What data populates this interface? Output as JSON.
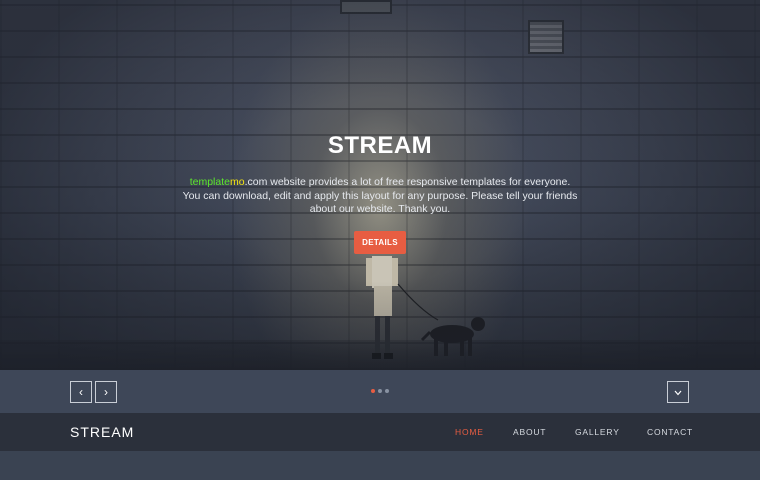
{
  "hero": {
    "title": "STREAM",
    "description_brand_part1": "template",
    "description_brand_part2": "mo",
    "description_rest": ".com website provides a lot of free responsive templates for everyone. You can download, edit and apply this layout for any purpose. Please tell your friends about our website. Thank you.",
    "details_label": "DETAILS",
    "brand_colors": {
      "template": "#5ce82c",
      "mo": "#f4e514"
    },
    "accent_color": "#e75d42"
  },
  "slider": {
    "prev_icon": "chevron-left-icon",
    "prev_glyph": "‹",
    "next_icon": "chevron-right-icon",
    "next_glyph": "›",
    "scroll_icon": "chevron-down-icon",
    "scroll_glyph": "⌄",
    "slide_count": 3,
    "active_slide": 1
  },
  "navbar": {
    "logo": "STREAM",
    "links": [
      {
        "label": "HOME",
        "active": true
      },
      {
        "label": "ABOUT",
        "active": false
      },
      {
        "label": "GALLERY",
        "active": false
      },
      {
        "label": "CONTACT",
        "active": false
      }
    ]
  }
}
